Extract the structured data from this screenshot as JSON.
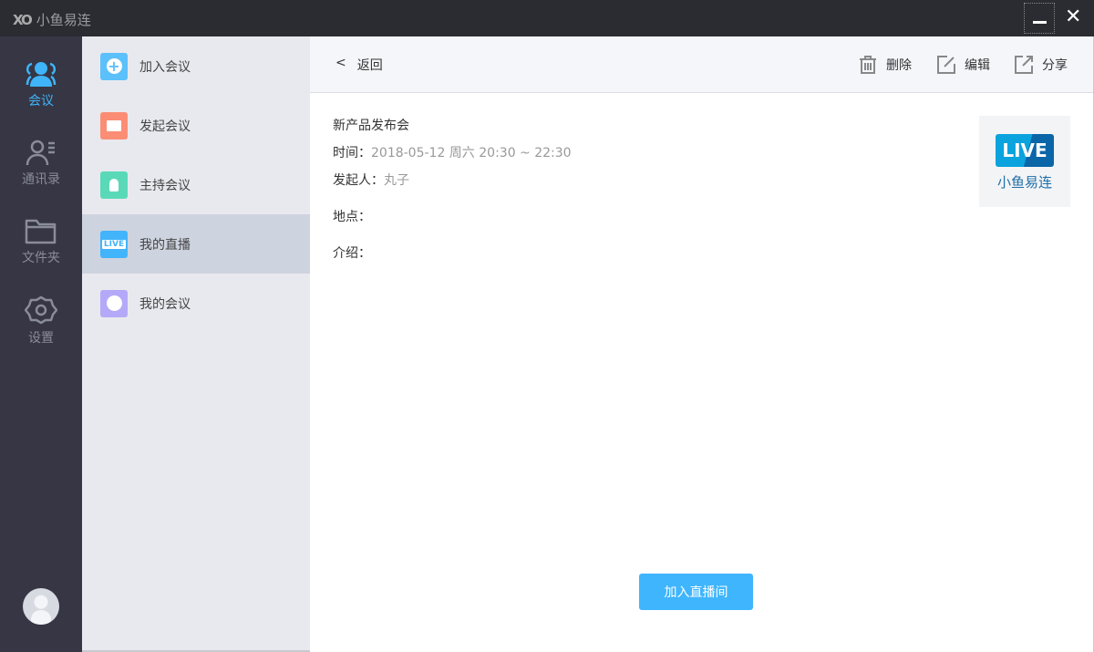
{
  "app": {
    "title": "小鱼易连"
  },
  "nav": [
    {
      "label": "会议",
      "icon": "people-icon"
    },
    {
      "label": "通讯录",
      "icon": "contacts-icon"
    },
    {
      "label": "文件夹",
      "icon": "folder-icon"
    },
    {
      "label": "设置",
      "icon": "gear-icon"
    }
  ],
  "submenu": [
    {
      "label": "加入会议",
      "color": "#5cc0fb"
    },
    {
      "label": "发起会议",
      "color": "#fb8d75"
    },
    {
      "label": "主持会议",
      "color": "#5ad9b8"
    },
    {
      "label": "我的直播",
      "color": "#42b4fb",
      "badge": "LIVE"
    },
    {
      "label": "我的会议",
      "color": "#b4a9f8"
    }
  ],
  "header": {
    "back": "返回",
    "delete": "删除",
    "edit": "编辑",
    "share": "分享"
  },
  "detail": {
    "title": "新产品发布会",
    "time_label": "时间：",
    "time_value": "2018-05-12 周六 20:30 ~ 22:30",
    "host_label": "发起人：",
    "host_value": "丸子",
    "location_label": "地点：",
    "intro_label": "介绍："
  },
  "live_card": {
    "badge": "LIVE",
    "brand": "小鱼易连"
  },
  "join_button": "加入直播间"
}
